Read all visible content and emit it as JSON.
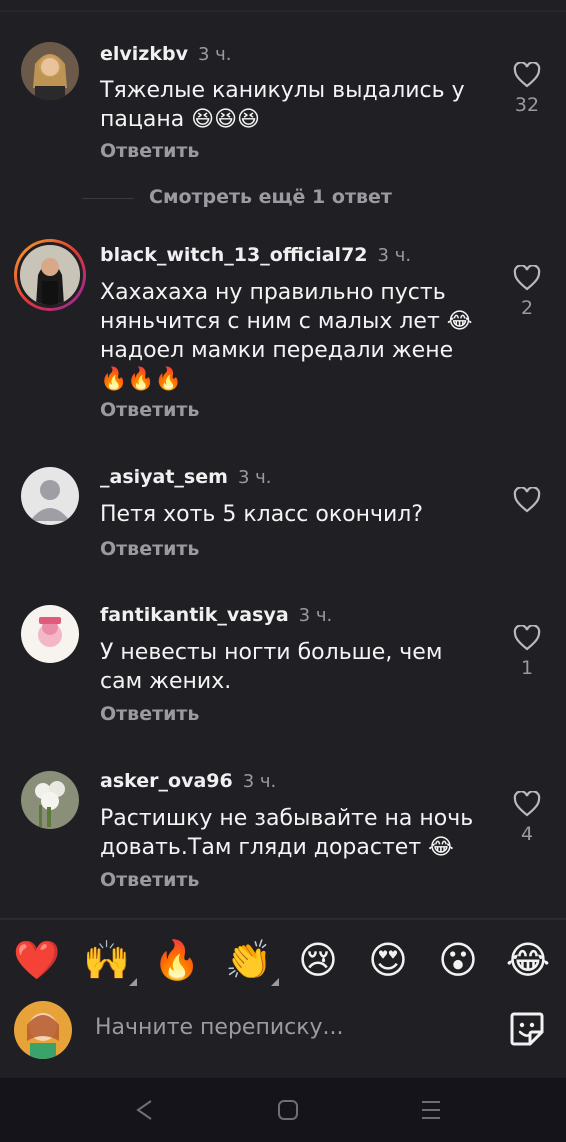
{
  "comments": [
    {
      "user": "elvizkbv",
      "time": "3 ч.",
      "lines": [
        "Тяжелые каникулы выдались у",
        "пацана 😆😆😆"
      ],
      "reply": "Ответить",
      "likes": "32"
    },
    {
      "user": "black_witch_13_official72",
      "time": "3 ч.",
      "lines": [
        "Хахахаха ну правильно пусть",
        "няньчится с ним с малых лет 😂",
        "надоел мамки передали жене",
        "🔥🔥🔥"
      ],
      "reply": "Ответить",
      "likes": "2"
    },
    {
      "user": "_asiyat_sem",
      "time": "3 ч.",
      "lines": [
        "Петя хоть 5 класс окончил?"
      ],
      "reply": "Ответить",
      "likes": ""
    },
    {
      "user": "fantikantik_vasya",
      "time": "3 ч.",
      "lines": [
        "У невесты ногти больше, чем",
        "сам жених."
      ],
      "reply": "Ответить",
      "likes": "1"
    },
    {
      "user": "asker_ova96",
      "time": "3 ч.",
      "lines": [
        "Растишку не забывайте на ночь",
        "довать.Там гляди дорастет 😂"
      ],
      "reply": "Ответить",
      "likes": "4"
    }
  ],
  "more_replies": "Смотреть ещё 1 ответ",
  "reactions": [
    "❤️",
    "🙌",
    "🔥",
    "👏",
    "😢",
    "😍",
    "😮",
    "😂"
  ],
  "input": {
    "placeholder": "Начните переписку..."
  },
  "icons": {
    "like": "heart-outline-icon",
    "sticker": "sticker-icon",
    "back": "back-icon",
    "home": "home-icon",
    "menu": "menu-icon"
  },
  "colors": {
    "background": "#1f1f24",
    "muted": "#9a9aa0",
    "text": "#f4f4f4"
  }
}
